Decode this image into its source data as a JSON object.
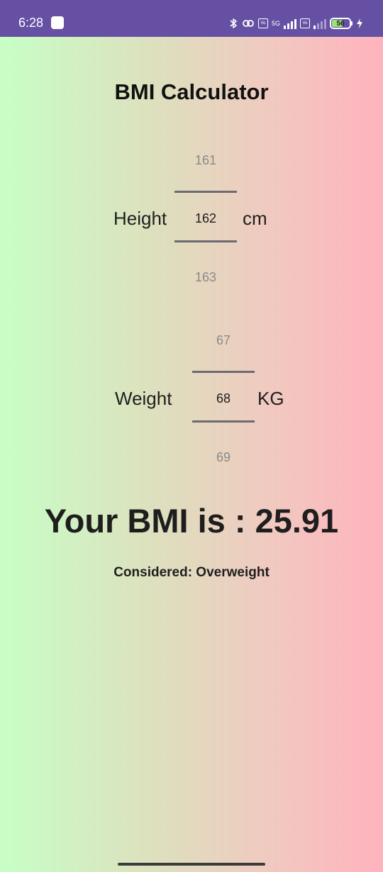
{
  "status_bar": {
    "time": "6:28",
    "net_label": "5G",
    "battery_level": "56",
    "icons": [
      "notification-icon",
      "bluetooth-icon",
      "link-icon",
      "volte-icon",
      "signal-icon",
      "battery-icon",
      "charging-icon"
    ]
  },
  "app": {
    "title": "BMI Calculator"
  },
  "height": {
    "label": "Height",
    "unit": "cm",
    "above": "161",
    "selected": "162",
    "below": "163"
  },
  "weight": {
    "label": "Weight",
    "unit": "KG",
    "above": "67",
    "selected": "68",
    "below": "69"
  },
  "result": {
    "bmi_text": "Your BMI is : 25.91",
    "category_text": "Considered: Overweight"
  },
  "colors": {
    "status_bar": "#6650a4",
    "gradient_start": "#c7ffc6",
    "gradient_end": "#ffb3bd"
  }
}
